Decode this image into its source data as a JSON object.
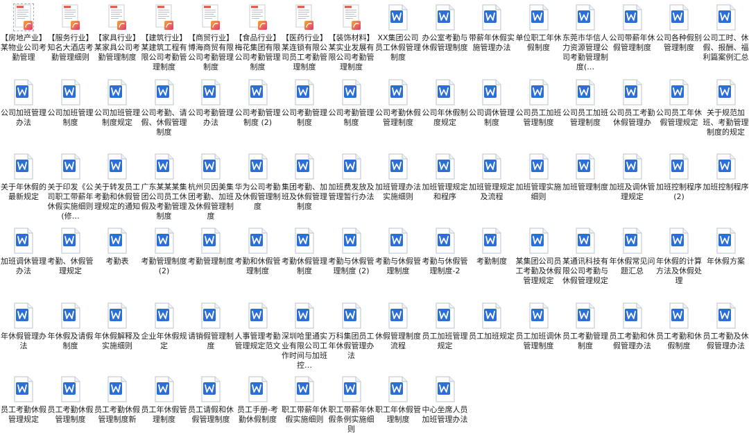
{
  "desktop": {
    "colors": {
      "word_blue": "#2b6fd6",
      "pdf_red": "#e24d3c",
      "pdf_badge_gradient": [
        "#f9a826",
        "#e2367a"
      ]
    },
    "rows": [
      [
        {
          "label": "【房地产业】某物业公司考勤管理",
          "type": "pdf",
          "icon": "pdf-file-icon"
        },
        {
          "label": "【服务行业】知名大酒店考勤管理细则",
          "type": "pdf",
          "icon": "pdf-file-icon"
        },
        {
          "label": "【家具行业】某家具公司考勤管理制度",
          "type": "pdf",
          "icon": "pdf-file-icon"
        },
        {
          "label": "【建筑行业】某建筑工程有限公司考勤管理制度",
          "type": "pdf",
          "icon": "pdf-file-icon"
        },
        {
          "label": "【商贸行业】博海商贸有限公司考勤管理制度",
          "type": "pdf",
          "icon": "pdf-file-icon"
        },
        {
          "label": "【食品行业】梅花集团有限公司考勤管理制度",
          "type": "pdf",
          "icon": "pdf-file-icon"
        },
        {
          "label": "【医药行业】某连锁有限公司员工考勤管理制度",
          "type": "pdf",
          "icon": "pdf-file-icon"
        },
        {
          "label": "【装饰材料】某实业发展有限公司考勤管理制度",
          "type": "pdf",
          "icon": "pdf-file-icon"
        },
        {
          "label": "XX集团公司员工休假管理制度",
          "type": "word",
          "icon": "word-file-icon"
        },
        {
          "label": "办公室考勤与休假管理制度",
          "type": "word",
          "icon": "word-file-icon"
        },
        {
          "label": "带薪年休假实施管理办法",
          "type": "word",
          "icon": "word-file-icon"
        },
        {
          "label": "单位职工年休假制度",
          "type": "word",
          "icon": "word-file-icon"
        },
        {
          "label": "东莞市华信人力资源管理公司考勤管理制度(…",
          "type": "word",
          "icon": "word-file-icon"
        },
        {
          "label": "公司带薪年休假管理制度",
          "type": "word",
          "icon": "word-file-icon"
        },
        {
          "label": "公司各种假别管理制度",
          "type": "word",
          "icon": "word-file-icon"
        },
        {
          "label": "公司工时、休假、报酬、福利篇案例汇总",
          "type": "word",
          "icon": "word-file-icon"
        }
      ],
      [
        {
          "label": "公司加班管理办法",
          "type": "word",
          "icon": "word-file-icon"
        },
        {
          "label": "公司加班管理制度",
          "type": "word",
          "icon": "word-file-icon"
        },
        {
          "label": "公司加班管理制度规定",
          "type": "word",
          "icon": "word-file-icon"
        },
        {
          "label": "公司考勤、请假、休假管理制度",
          "type": "word",
          "icon": "word-file-icon"
        },
        {
          "label": "公司考勤管理办法",
          "type": "word",
          "icon": "word-file-icon"
        },
        {
          "label": "公司考勤管理制度 (2)",
          "type": "word",
          "icon": "word-file-icon"
        },
        {
          "label": "公司考勤管理制度",
          "type": "word",
          "icon": "word-file-icon"
        },
        {
          "label": "公司考勤管理制度",
          "type": "word",
          "icon": "word-file-icon"
        },
        {
          "label": "公司考勤休假管理制度",
          "type": "word",
          "icon": "word-file-icon"
        },
        {
          "label": "公司年休假制度规定",
          "type": "word",
          "icon": "word-file-icon"
        },
        {
          "label": "公司调休管理制度",
          "type": "word",
          "icon": "word-file-icon"
        },
        {
          "label": "公司员工加班管理制度",
          "type": "word",
          "icon": "word-file-icon"
        },
        {
          "label": "公司员工加班管理制度",
          "type": "word",
          "icon": "word-file-icon"
        },
        {
          "label": "公司员工考勤休假管理办",
          "type": "word",
          "icon": "word-file-icon"
        },
        {
          "label": "公司员工年休假管理规定",
          "type": "word",
          "icon": "word-file-icon"
        },
        {
          "label": "关于规范加班、考勤管理制度的规定",
          "type": "word",
          "icon": "word-file-icon"
        }
      ],
      [
        {
          "label": "关于年休假的最新规定",
          "type": "word",
          "icon": "word-file-icon"
        },
        {
          "label": "关于印发《公司职工带薪年休假实施细则(修…",
          "type": "word",
          "icon": "word-file-icon"
        },
        {
          "label": "关于转发员工考勤和休假管理规定的通知",
          "type": "word",
          "icon": "word-file-icon"
        },
        {
          "label": "广东某某某集团公司员工休假及考勤管理制度",
          "type": "word",
          "icon": "word-file-icon"
        },
        {
          "label": "杭州贝因美集团考勤、加班及休假管理制度",
          "type": "word",
          "icon": "word-file-icon"
        },
        {
          "label": "华为公司考勤及休假管理制度",
          "type": "word",
          "icon": "word-file-icon"
        },
        {
          "label": "集团考勤、加班及休假管理制度",
          "type": "word",
          "icon": "word-file-icon"
        },
        {
          "label": "加班费发放及管理暂行办法",
          "type": "word",
          "icon": "word-file-icon"
        },
        {
          "label": "加班管理办法实施细则",
          "type": "word",
          "icon": "word-file-icon"
        },
        {
          "label": "加班管理规定和程序",
          "type": "word",
          "icon": "word-file-icon"
        },
        {
          "label": "加班管理规定及流程",
          "type": "word",
          "icon": "word-file-icon"
        },
        {
          "label": "加班管理实施细则",
          "type": "word",
          "icon": "word-file-icon"
        },
        {
          "label": "加班管理制度",
          "type": "word",
          "icon": "word-file-icon"
        },
        {
          "label": "加班及调休管理规定",
          "type": "word",
          "icon": "word-file-icon"
        },
        {
          "label": "加班控制程序 (2)",
          "type": "word",
          "icon": "word-file-icon"
        },
        {
          "label": "加班控制程序",
          "type": "word",
          "icon": "word-file-icon"
        }
      ],
      [
        {
          "label": "加班调休管理办法",
          "type": "word",
          "icon": "word-file-icon"
        },
        {
          "label": "考勤、休假管理规定",
          "type": "word",
          "icon": "word-file-icon"
        },
        {
          "label": "考勤表",
          "type": "word",
          "icon": "word-file-icon"
        },
        {
          "label": "考勤管理制度 (2)",
          "type": "word",
          "icon": "word-file-icon"
        },
        {
          "label": "考勤管理制度",
          "type": "word",
          "icon": "word-file-icon"
        },
        {
          "label": "考勤和休假管理制度",
          "type": "word",
          "icon": "word-file-icon"
        },
        {
          "label": "考勤休假管理制度",
          "type": "word",
          "icon": "word-file-icon"
        },
        {
          "label": "考勤与休假管理制度 (2)",
          "type": "word",
          "icon": "word-file-icon"
        },
        {
          "label": "考勤与休假管理制度",
          "type": "word",
          "icon": "word-file-icon"
        },
        {
          "label": "考勤与休假管理制度-2",
          "type": "word",
          "icon": "word-file-icon"
        },
        {
          "label": "考勤制度",
          "type": "word",
          "icon": "word-file-icon"
        },
        {
          "label": "某集团公司员工考勤及休假管理规定",
          "type": "word",
          "icon": "word-file-icon"
        },
        {
          "label": "某通讯科技有限公司考勤与休假管理规定",
          "type": "word",
          "icon": "word-file-icon"
        },
        {
          "label": "年休假常见问题汇总",
          "type": "word",
          "icon": "word-file-icon"
        },
        {
          "label": "年休假的计算方法及休假处理",
          "type": "word",
          "icon": "word-file-icon"
        },
        {
          "label": "年休假方案",
          "type": "word",
          "icon": "word-file-icon"
        }
      ],
      [
        {
          "label": "年休假管理办法",
          "type": "word",
          "icon": "word-file-icon"
        },
        {
          "label": "年休假及请假制度",
          "type": "word",
          "icon": "word-file-icon"
        },
        {
          "label": "年休假解释及实施细则",
          "type": "word",
          "icon": "word-file-icon"
        },
        {
          "label": "企业年休假规定",
          "type": "word",
          "icon": "word-file-icon"
        },
        {
          "label": "请销假管理制度",
          "type": "word",
          "icon": "word-file-icon"
        },
        {
          "label": "人事管理考勤管理规定范文",
          "type": "word",
          "icon": "word-file-icon"
        },
        {
          "label": "深圳哈里通实业有限公司工作时间与加班控…",
          "type": "word",
          "icon": "word-file-icon"
        },
        {
          "label": "万科集团员工年休假管理办法",
          "type": "word",
          "icon": "word-file-icon"
        },
        {
          "label": "休假管理制度流程",
          "type": "word",
          "icon": "word-file-icon"
        },
        {
          "label": "员工加班管理规定",
          "type": "word",
          "icon": "word-file-icon"
        },
        {
          "label": "员工加班规定",
          "type": "word",
          "icon": "word-file-icon"
        },
        {
          "label": "员工加班调休管理制度",
          "type": "word",
          "icon": "word-file-icon"
        },
        {
          "label": "员工考勤管理制度",
          "type": "word",
          "icon": "word-file-icon"
        },
        {
          "label": "员工考勤和休假管理办法",
          "type": "word",
          "icon": "word-file-icon"
        },
        {
          "label": "员工考勤和休假制度",
          "type": "word",
          "icon": "word-file-icon"
        },
        {
          "label": "员工考勤及休假管理办法",
          "type": "word",
          "icon": "word-file-icon"
        }
      ],
      [
        {
          "label": "员工考勤休假管理规定",
          "type": "word",
          "icon": "word-file-icon"
        },
        {
          "label": "员工考勤休假管理制度",
          "type": "word",
          "icon": "word-file-icon"
        },
        {
          "label": "员工考勤休假管理制度新",
          "type": "word",
          "icon": "word-file-icon"
        },
        {
          "label": "员工年休假管理制度",
          "type": "word",
          "icon": "word-file-icon"
        },
        {
          "label": "员工请假和休假管理制度",
          "type": "word",
          "icon": "word-file-icon"
        },
        {
          "label": "员工手册-考勤休假制度",
          "type": "word",
          "icon": "word-file-icon"
        },
        {
          "label": "职工带薪年休假实施细则",
          "type": "word",
          "icon": "word-file-icon"
        },
        {
          "label": "职工带薪年休假条例实施细则",
          "type": "word",
          "icon": "word-file-icon"
        },
        {
          "label": "职工年休假管理制度",
          "type": "word",
          "icon": "word-file-icon"
        },
        {
          "label": "中心坐席人员加班管理办法",
          "type": "word",
          "icon": "word-file-icon"
        }
      ]
    ]
  }
}
